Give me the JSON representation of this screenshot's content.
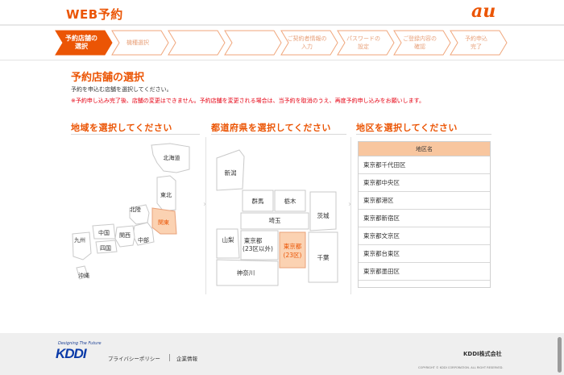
{
  "header": {
    "title": "WEB予約",
    "logo_text": "au"
  },
  "steps": [
    {
      "label": "予約店舗の\n選択",
      "active": true
    },
    {
      "label": "機種選択",
      "active": false
    },
    {
      "label": "",
      "active": false
    },
    {
      "label": "",
      "active": false
    },
    {
      "label": "ご契約者情報の\n入力",
      "active": false
    },
    {
      "label": "パスワードの\n設定",
      "active": false
    },
    {
      "label": "ご登録内容の\n確認",
      "active": false
    },
    {
      "label": "予約申込\n完了",
      "active": false
    }
  ],
  "page": {
    "title": "予約店舗の選択",
    "description": "予約を申込む店舗を選択してください。",
    "warning": "※予約申し込み完了後、店舗の変更はできません。予約店舗を変更される場合は、当予約を取消のうえ、再度予約申し込みをお願いします。"
  },
  "region_section": {
    "heading": "地域を選択してください",
    "regions": {
      "hokkaido": "北海道",
      "tohoku": "東北",
      "hokuriku": "北陸",
      "kanto": "関東",
      "chubu": "中部",
      "kansai": "関西",
      "chugoku": "中国",
      "shikoku": "四国",
      "kyushu": "九州",
      "okinawa": "沖縄"
    }
  },
  "prefecture_section": {
    "heading": "都道府県を選択してください",
    "prefectures": {
      "niigata": "新潟",
      "gunma": "群馬",
      "tochigi": "栃木",
      "saitama": "埼玉",
      "ibaraki": "茨城",
      "yamanashi": "山梨",
      "tokyo_outer_1": "東京都",
      "tokyo_outer_2": "(23区以外)",
      "tokyo_23_1": "東京都",
      "tokyo_23_2": "(23区)",
      "chiba": "千葉",
      "kanagawa": "神奈川"
    }
  },
  "district_section": {
    "heading": "地区を選択してください",
    "column_header": "地区名",
    "districts": [
      "東京都千代田区",
      "東京都中央区",
      "東京都港区",
      "東京都新宿区",
      "東京都文京区",
      "東京都台東区",
      "東京都墨田区"
    ]
  },
  "footer": {
    "tagline": "Designing The Future",
    "logo": "KDDI",
    "privacy": "プライバシーポリシー",
    "company": "企業情報",
    "corp_name": "KDDI株式会社",
    "copyright": "COPYRIGHT © KDDI CORPORATION. ALL RIGHT RESERVED."
  },
  "colors": {
    "accent": "#eb5505",
    "selected_fill": "#fbd2b2",
    "warning": "#e60012"
  }
}
